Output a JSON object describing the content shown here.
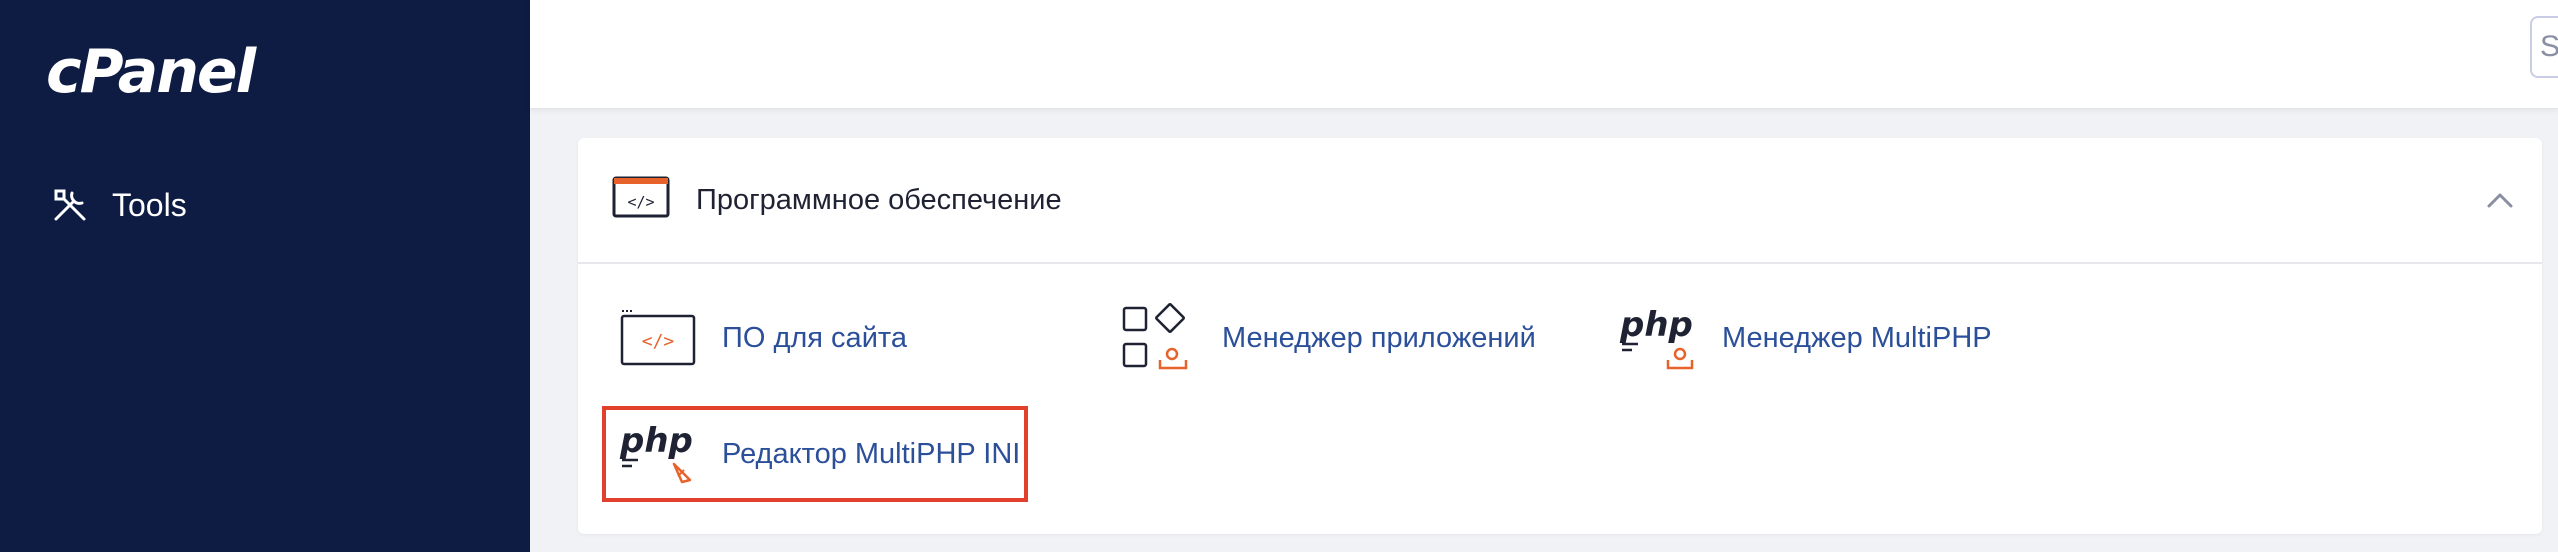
{
  "sidebar": {
    "logo": "cPanel",
    "nav_items": [
      {
        "label": "Tools",
        "icon": "tools-icon"
      }
    ]
  },
  "topbar": {
    "search_placeholder": "S"
  },
  "section": {
    "title": "Программное обеспечение",
    "icon": "code-window-icon",
    "collapse_icon": "chevron-up-icon"
  },
  "tools": [
    {
      "label": "ПО для сайта",
      "icon": "code-window-icon"
    },
    {
      "label": "Менеджер приложений",
      "icon": "app-grid-icon"
    },
    {
      "label": "Менеджер MultiPHP",
      "icon": "php-manager-icon"
    },
    {
      "label": "Редактор MultiPHP INI",
      "icon": "php-editor-icon",
      "highlighted": true
    }
  ],
  "colors": {
    "sidebar_bg": "#0e1c43",
    "accent": "#e8632b",
    "link": "#2c4f9a",
    "highlight": "#e0402c"
  }
}
